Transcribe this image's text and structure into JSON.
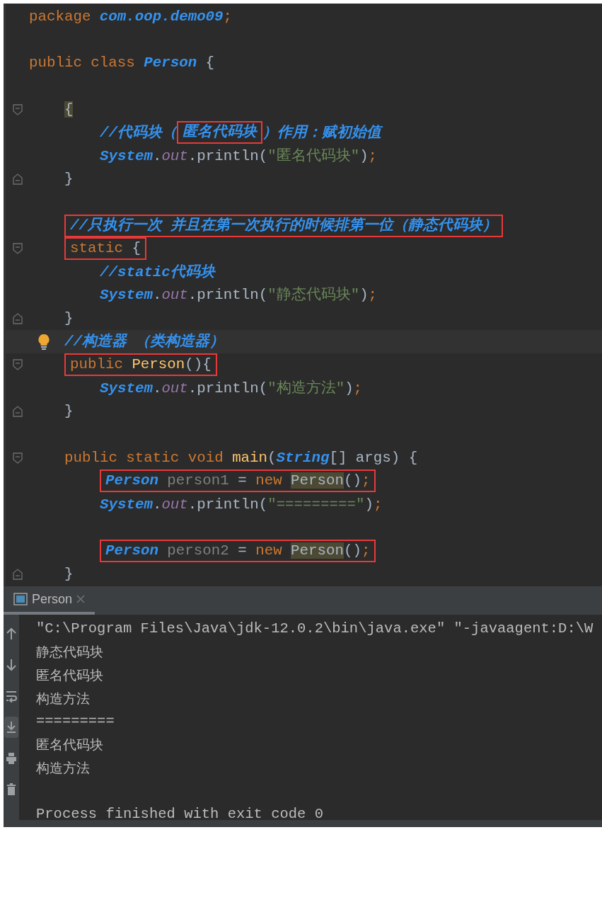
{
  "editor": {
    "lines": [
      {
        "tokens": [
          {
            "kind": "keyword",
            "text": "package "
          },
          {
            "kind": "type",
            "text": "com.oop.demo09"
          },
          {
            "kind": "semi",
            "text": ";"
          }
        ]
      },
      {
        "gap_before": true,
        "tokens": [
          {
            "kind": "keyword",
            "text": "public class "
          },
          {
            "kind": "type",
            "text": "Person"
          },
          {
            "kind": "plain",
            "text": " {"
          }
        ],
        "children": [
          {
            "gap_before": true,
            "fold_start": true,
            "tokens": [
              {
                "kind": "brace_match",
                "text": "{"
              }
            ],
            "children": [
              {
                "tokens": [
                  {
                    "kind": "comment",
                    "text": "//代码块（"
                  },
                  {
                    "kind": "box",
                    "tokens": [
                      {
                        "kind": "comment",
                        "text": "匿名代码块"
                      }
                    ]
                  },
                  {
                    "kind": "comment",
                    "text": "）作用：赋初始值"
                  }
                ]
              },
              {
                "tokens": [
                  {
                    "kind": "type",
                    "text": "System"
                  },
                  {
                    "kind": "plain",
                    "text": "."
                  },
                  {
                    "kind": "field",
                    "text": "out"
                  },
                  {
                    "kind": "plain",
                    "text": ".println("
                  },
                  {
                    "kind": "string",
                    "text": "\"匿名代码块\""
                  },
                  {
                    "kind": "plain",
                    "text": ")"
                  },
                  {
                    "kind": "semi",
                    "text": ";"
                  }
                ]
              }
            ]
          },
          {
            "fold_end": true,
            "tokens": [
              {
                "kind": "plain",
                "text": "}"
              }
            ]
          },
          {
            "gap_before": true,
            "tokens": [
              {
                "kind": "box",
                "tokens": [
                  {
                    "kind": "comment",
                    "text": "//只执行一次 并且在第一次执行的时候排第一位（静态代码块）"
                  }
                ]
              }
            ]
          },
          {
            "fold_start": true,
            "tokens": [
              {
                "kind": "box",
                "tokens": [
                  {
                    "kind": "keyword",
                    "text": "static "
                  },
                  {
                    "kind": "plain",
                    "text": "{"
                  }
                ]
              }
            ],
            "children": [
              {
                "tokens": [
                  {
                    "kind": "comment",
                    "text": "//static代码块"
                  }
                ]
              },
              {
                "tokens": [
                  {
                    "kind": "type",
                    "text": "System"
                  },
                  {
                    "kind": "plain",
                    "text": "."
                  },
                  {
                    "kind": "field",
                    "text": "out"
                  },
                  {
                    "kind": "plain",
                    "text": ".println("
                  },
                  {
                    "kind": "string",
                    "text": "\"静态代码块\""
                  },
                  {
                    "kind": "plain",
                    "text": ")"
                  },
                  {
                    "kind": "semi",
                    "text": ";"
                  }
                ]
              }
            ]
          },
          {
            "fold_end": true,
            "tokens": [
              {
                "kind": "plain",
                "text": "}"
              }
            ]
          },
          {
            "current": true,
            "bulb": true,
            "tokens": [
              {
                "kind": "comment",
                "text": "//构造器 （类构造器）"
              }
            ]
          },
          {
            "fold_start": true,
            "tokens": [
              {
                "kind": "box",
                "tokens": [
                  {
                    "kind": "keyword",
                    "text": "public "
                  },
                  {
                    "kind": "method",
                    "text": "Person"
                  },
                  {
                    "kind": "plain",
                    "text": "(){"
                  }
                ]
              }
            ],
            "children": [
              {
                "tokens": [
                  {
                    "kind": "type",
                    "text": "System"
                  },
                  {
                    "kind": "plain",
                    "text": "."
                  },
                  {
                    "kind": "field",
                    "text": "out"
                  },
                  {
                    "kind": "plain",
                    "text": ".println("
                  },
                  {
                    "kind": "string",
                    "text": "\"构造方法\""
                  },
                  {
                    "kind": "plain",
                    "text": ")"
                  },
                  {
                    "kind": "semi",
                    "text": ";"
                  }
                ]
              }
            ]
          },
          {
            "fold_end": true,
            "tokens": [
              {
                "kind": "plain",
                "text": "}"
              }
            ]
          },
          {
            "gap_before": true,
            "fold_start": true,
            "tokens": [
              {
                "kind": "keyword",
                "text": "public static void "
              },
              {
                "kind": "method",
                "text": "main"
              },
              {
                "kind": "plain",
                "text": "("
              },
              {
                "kind": "type",
                "text": "String"
              },
              {
                "kind": "plain",
                "text": "[] args) {"
              }
            ],
            "children": [
              {
                "tokens": [
                  {
                    "kind": "box",
                    "tokens": [
                      {
                        "kind": "type",
                        "text": "Person"
                      },
                      {
                        "kind": "unused",
                        "text": " person1 "
                      },
                      {
                        "kind": "plain",
                        "text": "= "
                      },
                      {
                        "kind": "keyword",
                        "text": "new "
                      },
                      {
                        "kind": "ref",
                        "text": "Person"
                      },
                      {
                        "kind": "plain",
                        "text": "()"
                      },
                      {
                        "kind": "semi",
                        "text": ";"
                      }
                    ]
                  }
                ]
              },
              {
                "tokens": [
                  {
                    "kind": "type",
                    "text": "System"
                  },
                  {
                    "kind": "plain",
                    "text": "."
                  },
                  {
                    "kind": "field",
                    "text": "out"
                  },
                  {
                    "kind": "plain",
                    "text": ".println("
                  },
                  {
                    "kind": "string",
                    "text": "\"=========\""
                  },
                  {
                    "kind": "plain",
                    "text": ")"
                  },
                  {
                    "kind": "semi",
                    "text": ";"
                  }
                ]
              },
              {
                "gap_before": true,
                "tokens": [
                  {
                    "kind": "box",
                    "tokens": [
                      {
                        "kind": "type",
                        "text": "Person"
                      },
                      {
                        "kind": "unused",
                        "text": " person2 "
                      },
                      {
                        "kind": "plain",
                        "text": "= "
                      },
                      {
                        "kind": "keyword",
                        "text": "new "
                      },
                      {
                        "kind": "ref",
                        "text": "Person"
                      },
                      {
                        "kind": "plain",
                        "text": "()"
                      },
                      {
                        "kind": "semi",
                        "text": ";"
                      }
                    ]
                  }
                ]
              }
            ]
          },
          {
            "fold_end": true,
            "tokens": [
              {
                "kind": "plain",
                "text": "}"
              }
            ]
          }
        ]
      }
    ]
  },
  "run_panel": {
    "tabs": [
      {
        "label": "Person",
        "selected": true
      }
    ],
    "tools": [
      {
        "kind": "up",
        "selected": false
      },
      {
        "kind": "down",
        "selected": false
      },
      {
        "kind": "wrap",
        "selected": false
      },
      {
        "kind": "scroll_end",
        "selected": true
      },
      {
        "kind": "print",
        "selected": false
      },
      {
        "kind": "trash",
        "selected": false
      }
    ],
    "output": [
      {
        "kind": "command",
        "text": "\"C:\\Program Files\\Java\\jdk-12.0.2\\bin\\java.exe\" \"-javaagent:D:\\W"
      },
      {
        "kind": "stdout",
        "text": "静态代码块"
      },
      {
        "kind": "stdout",
        "text": "匿名代码块"
      },
      {
        "kind": "stdout",
        "text": "构造方法"
      },
      {
        "kind": "command",
        "text": "========="
      },
      {
        "kind": "stdout",
        "text": "匿名代码块"
      },
      {
        "kind": "stdout",
        "text": "构造方法"
      },
      {
        "kind": "blank"
      },
      {
        "kind": "command",
        "text": "Process finished with exit code 0"
      }
    ]
  }
}
